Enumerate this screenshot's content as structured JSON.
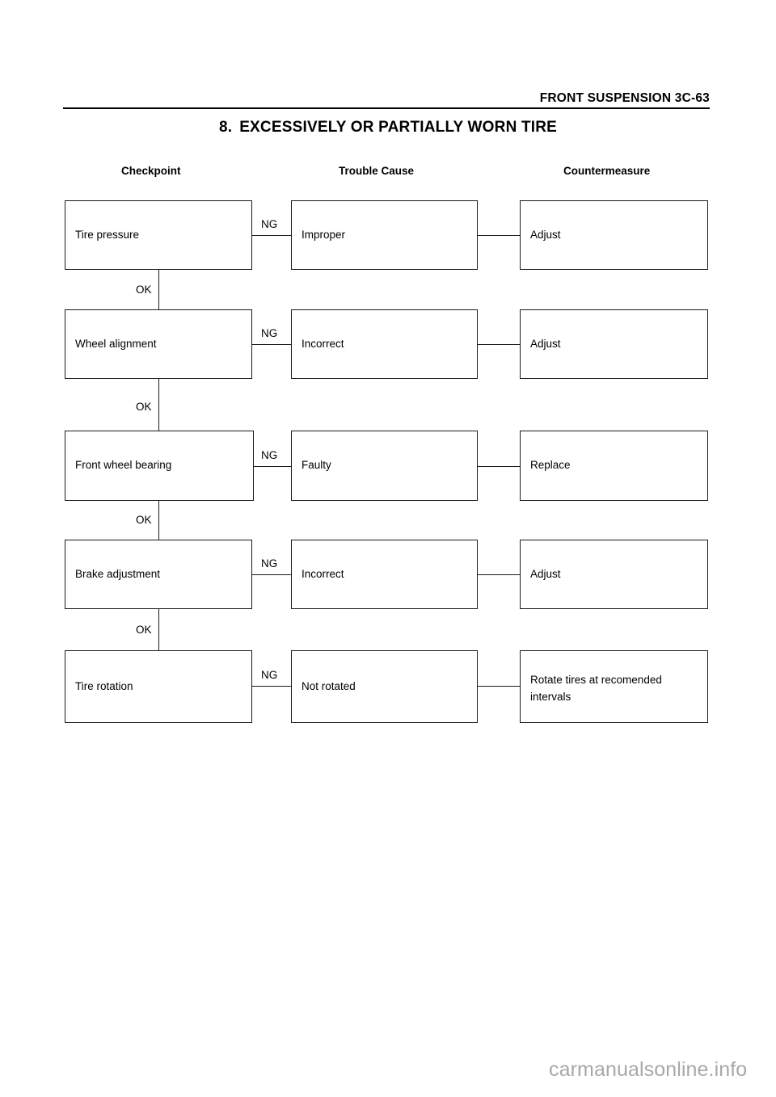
{
  "page": {
    "header_text": "FRONT SUSPENSION  3C-63",
    "title_number": "8.",
    "title_text": "EXCESSIVELY OR PARTIALLY WORN TIRE",
    "watermark": "carmanualsonline.info",
    "ink_color": "#1a1a1a",
    "watermark_color": "#a8a8a8"
  },
  "columns": {
    "checkpoint": "Checkpoint",
    "trouble_cause": "Trouble Cause",
    "countermeasure": "Countermeasure"
  },
  "edges": {
    "ng": "NG",
    "ok": "OK"
  },
  "rows": [
    {
      "checkpoint": "Tire pressure",
      "ng_label": "NG",
      "trouble_cause": "Improper",
      "countermeasure": "Adjust",
      "ok_label": "OK"
    },
    {
      "checkpoint": "Wheel alignment",
      "ng_label": "NG",
      "trouble_cause": "Incorrect",
      "countermeasure": "Adjust",
      "ok_label": "OK"
    },
    {
      "checkpoint": "Front wheel bearing",
      "ng_label": "NG",
      "trouble_cause": "Faulty",
      "countermeasure": "Replace",
      "ok_label": "OK"
    },
    {
      "checkpoint": "Brake adjustment",
      "ng_label": "NG",
      "trouble_cause": "Incorrect",
      "countermeasure": "Adjust",
      "ok_label": "OK"
    },
    {
      "checkpoint": "Tire rotation",
      "ng_label": "NG",
      "trouble_cause": "Not rotated",
      "countermeasure": "Rotate tires at recomended intervals",
      "ok_label": ""
    }
  ]
}
